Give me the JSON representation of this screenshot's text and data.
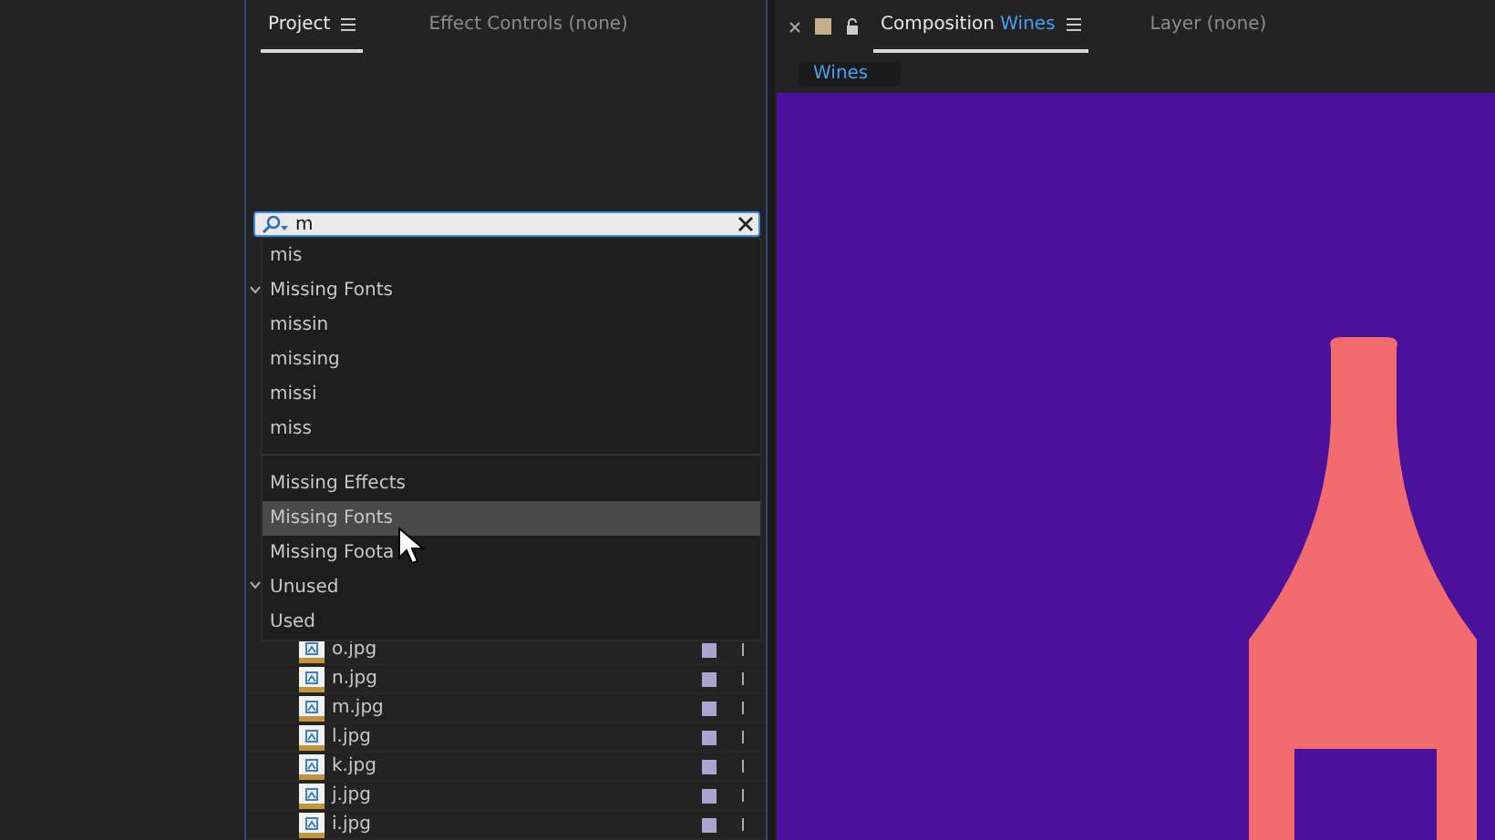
{
  "project_panel": {
    "tabs": [
      {
        "label": "Project",
        "selected": true
      },
      {
        "label": "Effect Controls (none)",
        "selected": false
      }
    ],
    "search": {
      "value": "m"
    },
    "menu": {
      "recent": [
        {
          "label": "mis",
          "selected": false
        },
        {
          "label": "Missing Fonts",
          "selected": false
        },
        {
          "label": "missin",
          "selected": false
        },
        {
          "label": "missing",
          "selected": false
        },
        {
          "label": "missi",
          "selected": false
        },
        {
          "label": "miss",
          "selected": false
        }
      ],
      "filters": [
        {
          "label": "Missing Effects",
          "selected": false
        },
        {
          "label": "Missing Fonts",
          "selected": true
        },
        {
          "label": "Missing Foota",
          "selected": false
        },
        {
          "label": "Unused",
          "selected": false
        },
        {
          "label": "Used",
          "selected": false
        }
      ]
    },
    "files": [
      {
        "name": "o.jpg",
        "color": "#a9a5d0"
      },
      {
        "name": "n.jpg",
        "color": "#a9a5d0"
      },
      {
        "name": "m.jpg",
        "color": "#a9a5d0"
      },
      {
        "name": "l.jpg",
        "color": "#a9a5d0"
      },
      {
        "name": "k.jpg",
        "color": "#a9a5d0"
      },
      {
        "name": "j.jpg",
        "color": "#a9a5d0"
      },
      {
        "name": "i.jpg",
        "color": "#a9a5d0"
      }
    ]
  },
  "composition_panel": {
    "tabs": [
      {
        "prefix": "Composition",
        "name": "Wines",
        "selected": true
      },
      {
        "prefix": "Layer",
        "name": "(none)",
        "selected": false
      }
    ],
    "breadcrumb": "Wines"
  }
}
